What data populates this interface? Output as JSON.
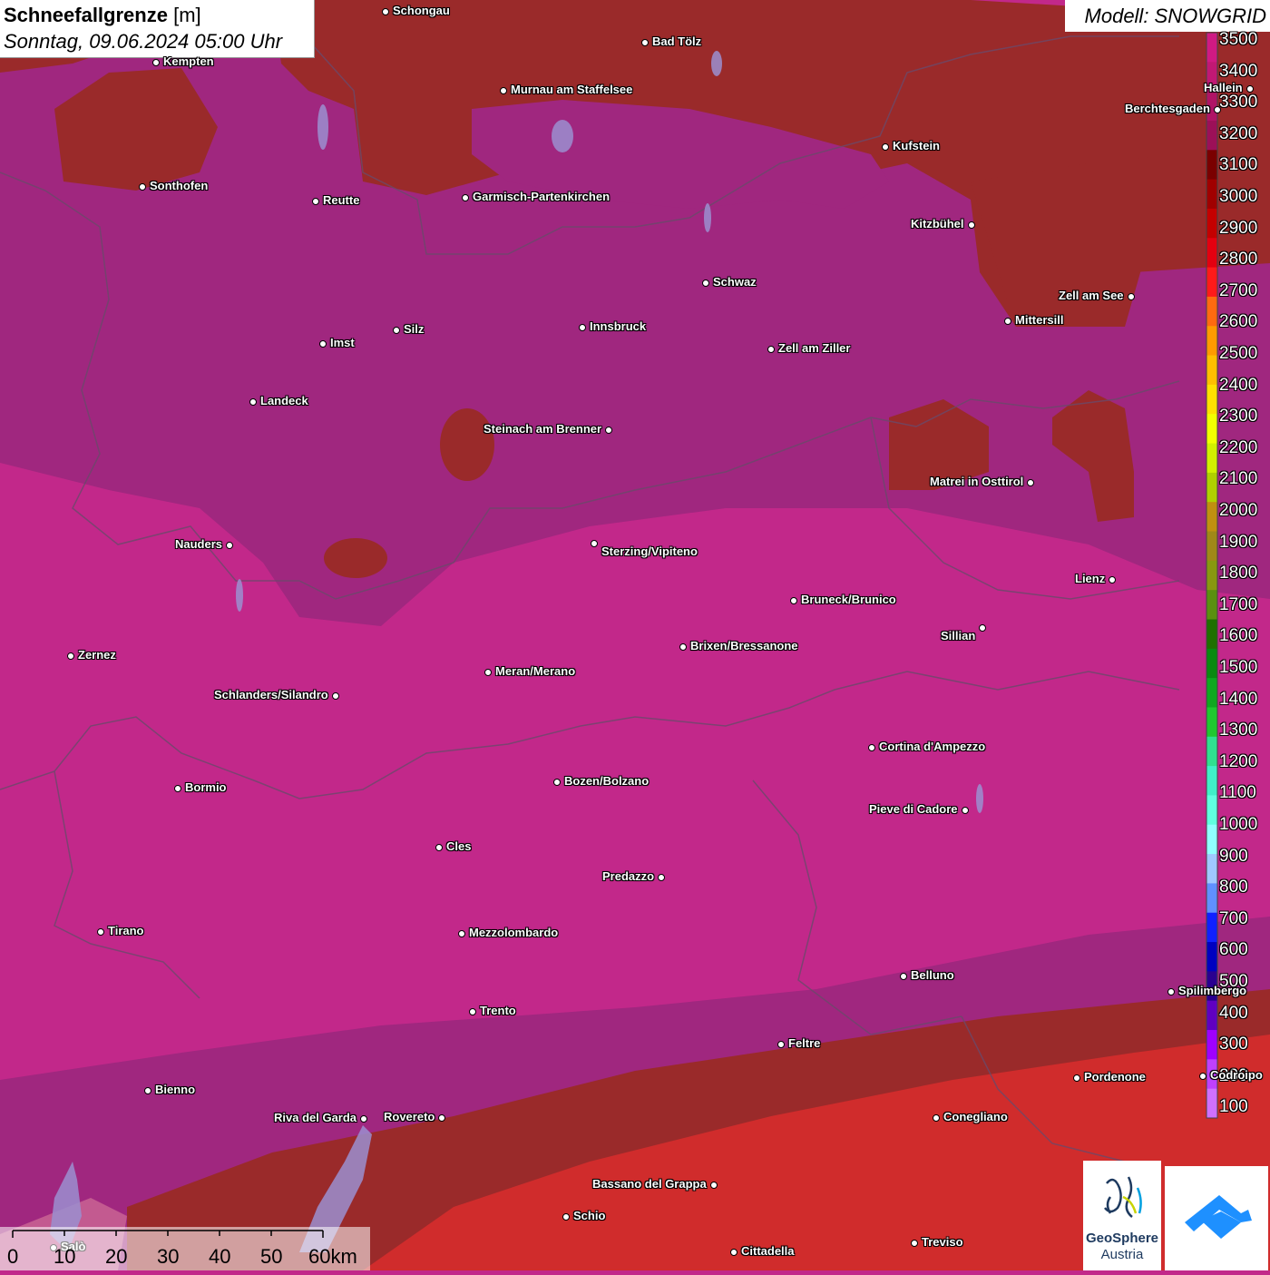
{
  "header": {
    "title_bold": "Schneefallgrenze",
    "title_unit": "[m]",
    "datetime": "Sonntag, 09.06.2024 05:00 Uhr",
    "model": "Modell: SNOWGRID"
  },
  "legend": {
    "values": [
      "3500",
      "3400",
      "3300",
      "3200",
      "3100",
      "3000",
      "2900",
      "2800",
      "2700",
      "2600",
      "2500",
      "2400",
      "2300",
      "2200",
      "2100",
      "2000",
      "1900",
      "1800",
      "1700",
      "1600",
      "1500",
      "1400",
      "1300",
      "1200",
      "1100",
      "1000",
      "900",
      "800",
      "700",
      "600",
      "500",
      "400",
      "300",
      "200",
      "100"
    ],
    "colors": [
      "#d01a83",
      "#c11874",
      "#b01466",
      "#9c1058",
      "#7a0000",
      "#a00000",
      "#c40000",
      "#e40010",
      "#ff1a1a",
      "#ff6a10",
      "#ff9a00",
      "#ffbf00",
      "#ffe000",
      "#f2ff00",
      "#d2f000",
      "#b0d000",
      "#c09010",
      "#a08818",
      "#889810",
      "#5a9010",
      "#207000",
      "#0a8a10",
      "#10a820",
      "#20c830",
      "#30e090",
      "#40f0c8",
      "#60ffe0",
      "#90ffff",
      "#a0c8ff",
      "#6090ff",
      "#1020ff",
      "#0000c0",
      "#2a0090",
      "#6000c0",
      "#a000ff",
      "#c040ff",
      "#d070ff"
    ]
  },
  "scale": {
    "labels": [
      "0",
      "10",
      "20",
      "30",
      "40",
      "50",
      "60km"
    ]
  },
  "logos": {
    "geosphere_line1": "GeoSphere",
    "geosphere_line2": "Austria"
  },
  "cities": [
    {
      "name": "Schongau"
    },
    {
      "name": "Kempten"
    },
    {
      "name": "Bad Tölz"
    },
    {
      "name": "Murnau am Staffelsee"
    },
    {
      "name": "Kufstein"
    },
    {
      "name": "Berchtesgaden"
    },
    {
      "name": "Hallein"
    },
    {
      "name": "Sonthofen"
    },
    {
      "name": "Reutte"
    },
    {
      "name": "Garmisch-Partenkirchen"
    },
    {
      "name": "Kitzbühel"
    },
    {
      "name": "Schwaz"
    },
    {
      "name": "Zell am See"
    },
    {
      "name": "Mittersill"
    },
    {
      "name": "Innsbruck"
    },
    {
      "name": "Imst"
    },
    {
      "name": "Silz"
    },
    {
      "name": "Zell am Ziller"
    },
    {
      "name": "Landeck"
    },
    {
      "name": "Steinach am Brenner"
    },
    {
      "name": "Matrei in Osttirol"
    },
    {
      "name": "Nauders"
    },
    {
      "name": "Sterzing/Vipiteno"
    },
    {
      "name": "Lienz"
    },
    {
      "name": "Bruneck/Brunico"
    },
    {
      "name": "Sillian"
    },
    {
      "name": "Zernez"
    },
    {
      "name": "Brixen/Bressanone"
    },
    {
      "name": "Meran/Merano"
    },
    {
      "name": "Schlanders/Silandro"
    },
    {
      "name": "Cortina d'Ampezzo"
    },
    {
      "name": "Bormio"
    },
    {
      "name": "Bozen/Bolzano"
    },
    {
      "name": "Pieve di Cadore"
    },
    {
      "name": "Cles"
    },
    {
      "name": "Predazzo"
    },
    {
      "name": "Tirano"
    },
    {
      "name": "Mezzolombardo"
    },
    {
      "name": "Belluno"
    },
    {
      "name": "Spilimbergo"
    },
    {
      "name": "Trento"
    },
    {
      "name": "Feltre"
    },
    {
      "name": "Pordenone"
    },
    {
      "name": "Codroipo"
    },
    {
      "name": "Bienno"
    },
    {
      "name": "Riva del Garda"
    },
    {
      "name": "Rovereto"
    },
    {
      "name": "Conegliano"
    },
    {
      "name": "Bassano del Grappa"
    },
    {
      "name": "Schio"
    },
    {
      "name": "Treviso"
    },
    {
      "name": "Cittadella"
    },
    {
      "name": "Salò"
    }
  ]
}
